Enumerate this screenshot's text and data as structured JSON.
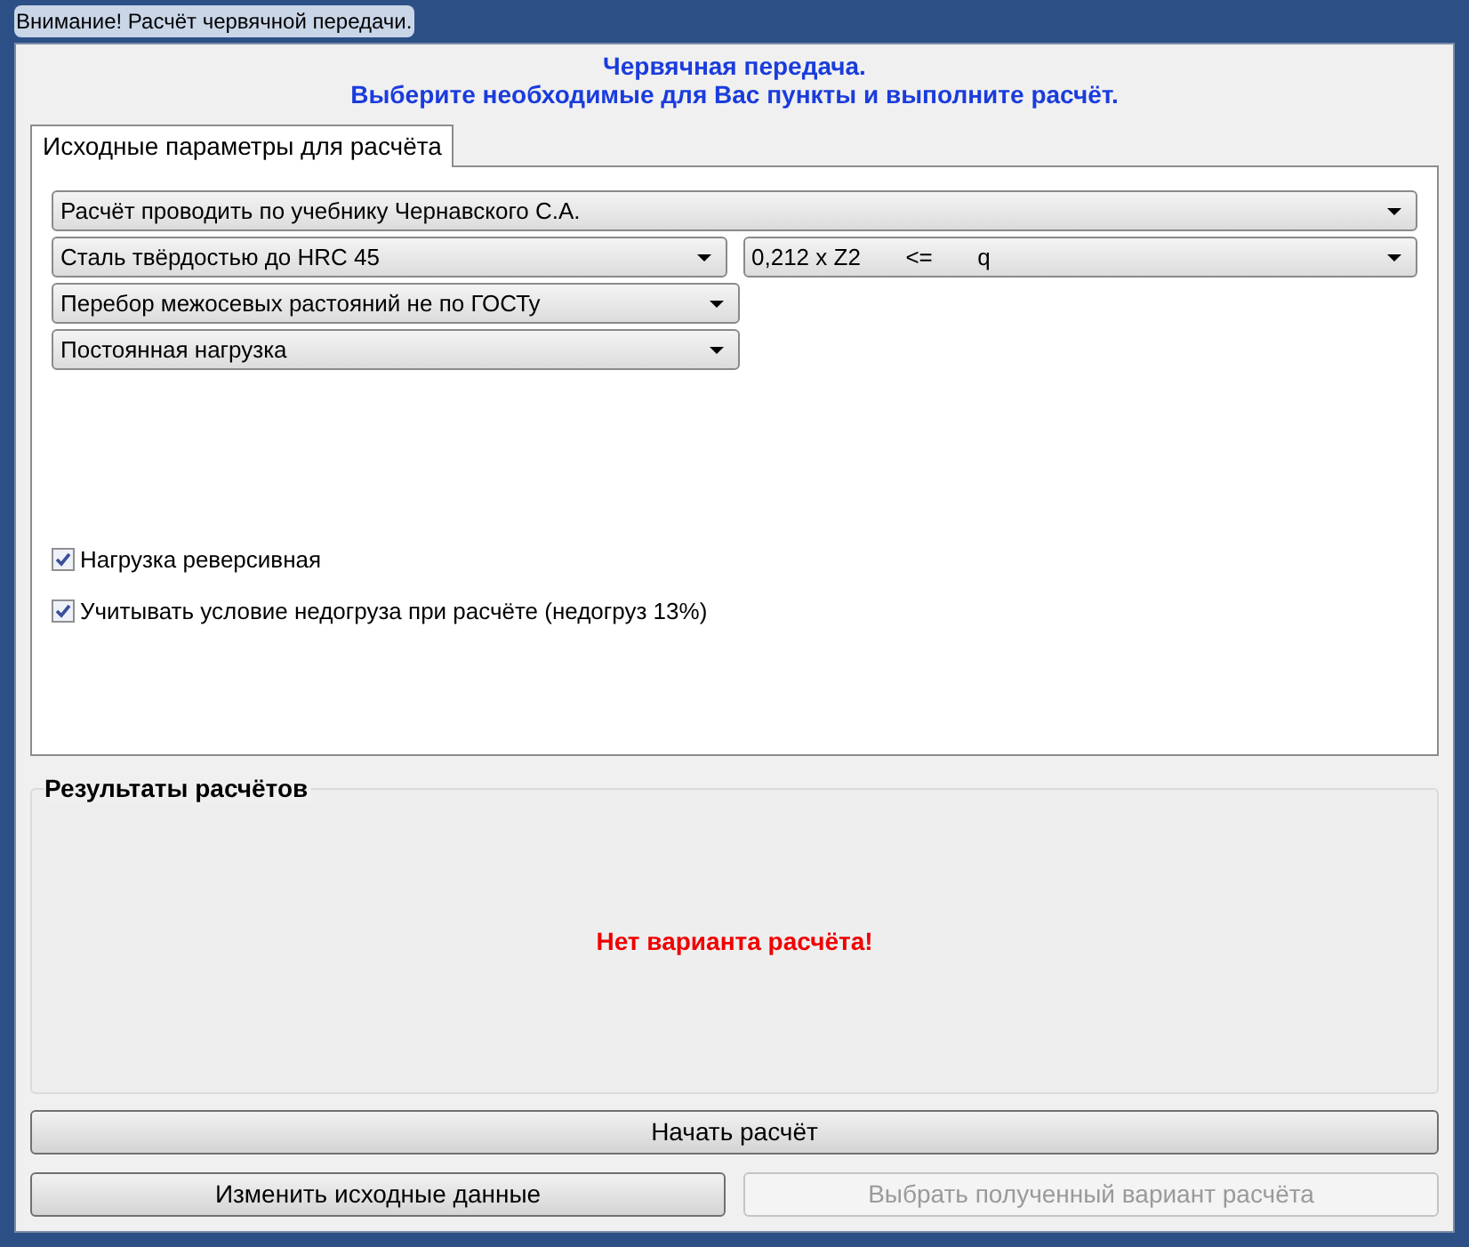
{
  "window": {
    "title": "Внимание! Расчёт червячной передачи."
  },
  "heading": [
    "Червячная передача.",
    "Выберите необходимые для Вас пункты и выполните расчёт."
  ],
  "tabs": [
    {
      "label": "Исходные параметры для расчёта",
      "selected": true
    }
  ],
  "dropdown_rows": [
    [
      {
        "value": "Расчёт проводить по учебнику Чернавского С.А."
      }
    ],
    [
      {
        "value": "Сталь твёрдостью до HRC 45"
      },
      {
        "value": "0,212 x Z2       <=       q"
      }
    ],
    [
      {
        "value": "Перебор межосевых растояний не по ГОСТу"
      }
    ],
    [
      {
        "value": "Постоянная нагрузка"
      }
    ]
  ],
  "checkboxes": [
    {
      "label": "Нагрузка реверсивная",
      "checked": true
    },
    {
      "label": "Учитывать условие недогруза при расчёте (недогруз 13%)",
      "checked": true
    }
  ],
  "results": {
    "title": "Результаты расчётов",
    "message": "Нет варианта расчёта!"
  },
  "buttons": [
    [
      {
        "label": "Начать расчёт",
        "disabled": false
      }
    ],
    [
      {
        "label": "Изменить исходные данные",
        "disabled": false
      },
      {
        "label": "Выбрать полученный вариант расчёта",
        "disabled": true
      }
    ]
  ]
}
